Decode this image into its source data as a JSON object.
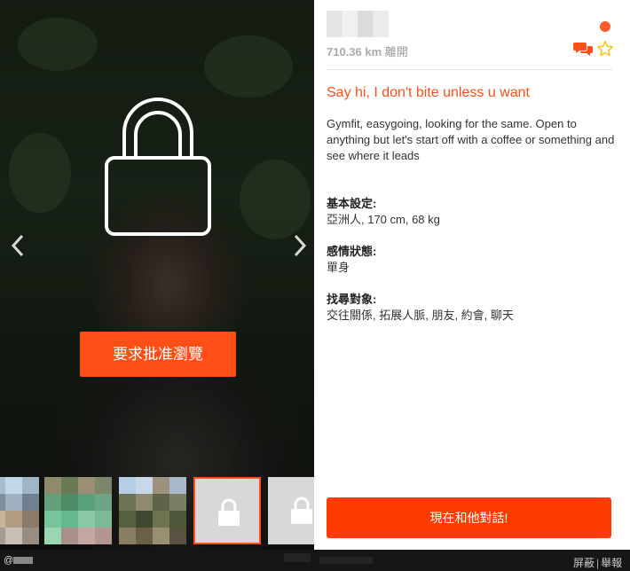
{
  "profile": {
    "distance_value": "710.36 km",
    "distance_suffix": "離開",
    "headline": "Say hi, I don't bite unless u want",
    "about": "Gymfit, easygoing, looking for the same. Open to anything but let's start off with a coffee or something and see where it leads",
    "sections": [
      {
        "label": "基本設定:",
        "value": "亞洲人, 170 cm, 68 kg"
      },
      {
        "label": "感情狀態:",
        "value": "單身"
      },
      {
        "label": "找尋對象:",
        "value": "交往關係, 拓展人脈, 朋友, 約會, 聊天"
      }
    ]
  },
  "photo": {
    "request_button_label": "要求批准瀏覽"
  },
  "chat_button_label": "現在和他對話!",
  "footer": {
    "handle_prefix": "@",
    "block_label": "屏蔽",
    "report_label": "舉報",
    "separator": "|"
  },
  "colors": {
    "accent": "#ff4f16",
    "online": "#ff5a2b",
    "star": "#f5c518"
  },
  "icons": [
    "lock-icon",
    "chevron-left-icon",
    "chevron-right-icon",
    "chat-bubbles-icon",
    "star-outline-icon"
  ]
}
